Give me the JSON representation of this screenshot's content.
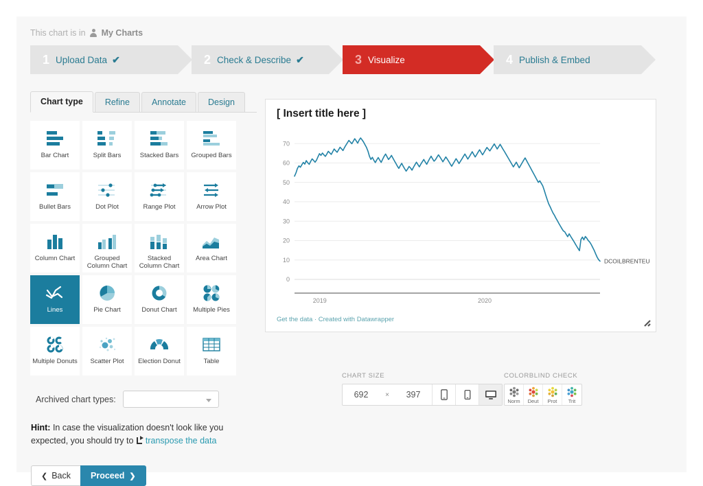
{
  "breadcrumb": {
    "prefix": "This chart is in",
    "location": "My Charts",
    "icon": "person-icon"
  },
  "steps": [
    {
      "num": "1",
      "label": "Upload Data",
      "check": "✔",
      "active": false
    },
    {
      "num": "2",
      "label": "Check & Describe",
      "check": "✔",
      "active": false
    },
    {
      "num": "3",
      "label": "Visualize",
      "check": "",
      "active": true
    },
    {
      "num": "4",
      "label": "Publish & Embed",
      "check": "",
      "active": false
    }
  ],
  "tabs": [
    {
      "label": "Chart type",
      "active": true
    },
    {
      "label": "Refine",
      "active": false
    },
    {
      "label": "Annotate",
      "active": false
    },
    {
      "label": "Design",
      "active": false
    }
  ],
  "chart_types": [
    {
      "label": "Bar Chart",
      "icon": "bar-chart-icon",
      "selected": false
    },
    {
      "label": "Split Bars",
      "icon": "split-bars-icon",
      "selected": false
    },
    {
      "label": "Stacked Bars",
      "icon": "stacked-bars-icon",
      "selected": false
    },
    {
      "label": "Grouped Bars",
      "icon": "grouped-bars-icon",
      "selected": false
    },
    {
      "label": "Bullet Bars",
      "icon": "bullet-bars-icon",
      "selected": false
    },
    {
      "label": "Dot Plot",
      "icon": "dot-plot-icon",
      "selected": false
    },
    {
      "label": "Range Plot",
      "icon": "range-plot-icon",
      "selected": false
    },
    {
      "label": "Arrow Plot",
      "icon": "arrow-plot-icon",
      "selected": false
    },
    {
      "label": "Column Chart",
      "icon": "column-chart-icon",
      "selected": false
    },
    {
      "label": "Grouped Column Chart",
      "icon": "grouped-column-chart-icon",
      "selected": false
    },
    {
      "label": "Stacked Column Chart",
      "icon": "stacked-column-chart-icon",
      "selected": false
    },
    {
      "label": "Area Chart",
      "icon": "area-chart-icon",
      "selected": false
    },
    {
      "label": "Lines",
      "icon": "lines-icon",
      "selected": true
    },
    {
      "label": "Pie Chart",
      "icon": "pie-chart-icon",
      "selected": false
    },
    {
      "label": "Donut Chart",
      "icon": "donut-chart-icon",
      "selected": false
    },
    {
      "label": "Multiple Pies",
      "icon": "multiple-pies-icon",
      "selected": false
    },
    {
      "label": "Multiple Donuts",
      "icon": "multiple-donuts-icon",
      "selected": false
    },
    {
      "label": "Scatter Plot",
      "icon": "scatter-plot-icon",
      "selected": false
    },
    {
      "label": "Election Donut",
      "icon": "election-donut-icon",
      "selected": false
    },
    {
      "label": "Table",
      "icon": "table-icon",
      "selected": false
    }
  ],
  "archived": {
    "label": "Archived chart types:",
    "value": ""
  },
  "hint": {
    "prefix": "Hint:",
    "text_1": "In case the visualization doesn't look like you expected, you should try to",
    "link": "transpose the data"
  },
  "nav": {
    "back": "Back",
    "proceed": "Proceed",
    "back_chevron": "❮",
    "proceed_chevron": "❯"
  },
  "chart_size": {
    "caption": "CHART SIZE",
    "width": "692",
    "separator": "×",
    "height": "397",
    "devices": [
      {
        "name": "mobile",
        "active": false
      },
      {
        "name": "tablet",
        "active": false
      },
      {
        "name": "desktop",
        "active": true
      }
    ]
  },
  "colorblind": {
    "caption": "COLORBLIND CHECK",
    "items": [
      {
        "label": "Norm"
      },
      {
        "label": "Deut"
      },
      {
        "label": "Prot"
      },
      {
        "label": "Trit"
      }
    ]
  },
  "chart_data": {
    "type": "line",
    "title": "[ Insert title here ]",
    "xlabel": "",
    "ylabel": "",
    "series_label": "DCOILBRENTEU",
    "line_color": "#2282a6",
    "ylim": [
      0,
      75
    ],
    "yticks": [
      0,
      10,
      20,
      30,
      40,
      50,
      60,
      70
    ],
    "xticks": [
      "2019",
      "2020"
    ],
    "grid": true,
    "legend_position": "right-inline",
    "footer": "Get the data · Created with Datawrapper",
    "series": [
      {
        "name": "DCOILBRENTEU",
        "values": [
          53.2,
          54.9,
          57.2,
          58.5,
          57.8,
          59.1,
          60.3,
          59.4,
          61.2,
          60.1,
          59.3,
          60.8,
          62.1,
          61.3,
          60.4,
          61.5,
          63.2,
          64.8,
          63.9,
          65.1,
          64.2,
          63.4,
          64.6,
          66.0,
          65.2,
          64.4,
          65.8,
          67.2,
          66.3,
          65.5,
          66.8,
          68.1,
          67.3,
          66.4,
          67.9,
          69.2,
          70.4,
          71.6,
          70.8,
          69.9,
          71.2,
          72.5,
          71.4,
          70.2,
          71.8,
          72.9,
          71.9,
          70.8,
          69.4,
          68.0,
          66.1,
          63.5,
          61.8,
          62.9,
          61.4,
          60.2,
          61.6,
          62.8,
          61.5,
          60.3,
          61.9,
          63.4,
          64.6,
          63.2,
          61.8,
          62.7,
          63.9,
          62.5,
          61.1,
          59.8,
          58.4,
          57.2,
          58.6,
          59.8,
          58.3,
          57.0,
          55.8,
          56.9,
          58.2,
          57.4,
          56.3,
          57.8,
          59.1,
          60.4,
          59.2,
          58.0,
          59.4,
          60.6,
          61.8,
          60.5,
          59.3,
          60.8,
          62.2,
          63.5,
          62.1,
          60.9,
          61.7,
          63.0,
          64.2,
          63.1,
          61.9,
          60.6,
          61.8,
          63.1,
          62.0,
          60.8,
          59.5,
          58.3,
          59.6,
          60.9,
          62.2,
          61.0,
          59.7,
          60.9,
          62.1,
          63.4,
          64.6,
          63.3,
          62.0,
          63.2,
          64.5,
          65.8,
          64.4,
          63.1,
          64.3,
          65.6,
          66.8,
          65.5,
          64.2,
          65.4,
          66.7,
          68.0,
          67.1,
          66.2,
          67.4,
          68.6,
          69.8,
          68.5,
          67.2,
          68.4,
          69.6,
          68.3,
          67.0,
          65.8,
          64.5,
          63.2,
          61.9,
          60.6,
          59.3,
          58.0,
          59.2,
          60.4,
          58.9,
          57.5,
          58.8,
          60.1,
          61.4,
          62.6,
          61.2,
          59.8,
          58.4,
          57.0,
          55.6,
          54.2,
          52.8,
          51.4,
          50.0,
          50.8,
          49.5,
          48.2,
          46.0,
          43.5,
          41.2,
          39.0,
          37.5,
          35.8,
          34.2,
          33.0,
          31.5,
          30.2,
          28.8,
          27.5,
          26.2,
          25.0,
          24.5,
          23.2,
          22.0,
          23.5,
          22.2,
          21.0,
          19.8,
          18.5,
          17.2,
          16.0,
          14.8,
          20.5,
          21.8,
          20.4,
          22.1,
          21.2,
          20.0,
          19.2,
          18.0,
          16.5,
          15.0,
          13.2,
          11.5,
          10.2,
          9.4
        ]
      }
    ]
  }
}
